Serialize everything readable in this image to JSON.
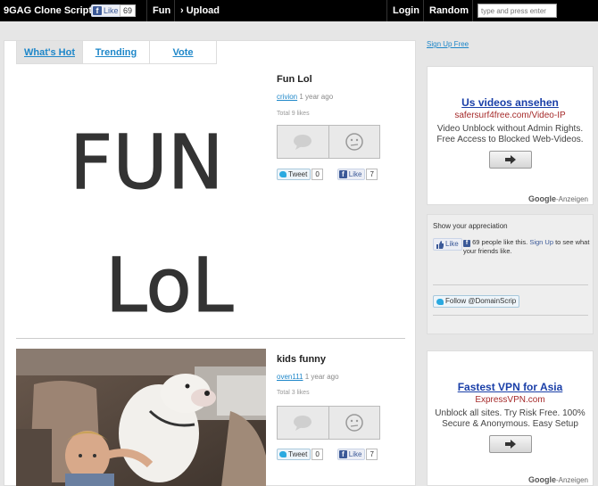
{
  "topbar": {
    "brand": "9GAG Clone Script",
    "like_label": "Like",
    "like_count": "69",
    "fun": "Fun",
    "upload": "› Upload",
    "login": "Login",
    "random": "Random",
    "search_placeholder": "type and press enter"
  },
  "tabs": [
    {
      "label": "What's Hot",
      "active": true
    },
    {
      "label": "Trending",
      "active": false
    },
    {
      "label": "Vote",
      "active": false
    }
  ],
  "posts": [
    {
      "title": "Fun Lol",
      "user": "crivion",
      "time": " 1 year ago",
      "likes": "Total 9 likes",
      "image_text": [
        "FUN",
        "LoL"
      ],
      "tweet_label": "Tweet",
      "tweet_count": "0",
      "fb_label": "Like",
      "fb_count": "7"
    },
    {
      "title": "kids funny",
      "user": "oven111",
      "time": " 1 year ago",
      "likes": "Total 3 likes",
      "tweet_label": "Tweet",
      "tweet_count": "0",
      "fb_label": "Like",
      "fb_count": "7"
    }
  ],
  "sidebar": {
    "signup": "Sign Up Free",
    "ads": [
      {
        "title": "Us videos ansehen",
        "url": "safersurf4free.com/Video-IP",
        "desc": "Video Unblock without Admin Rights. Free Access to Blocked Web-Videos.",
        "google": "Google",
        "google_suffix": "-Anzeigen"
      },
      {
        "title": "Fastest VPN for Asia",
        "url": "ExpressVPN.com",
        "desc": "Unblock all sites. Try Risk Free. 100% Secure & Anonymous. Easy Setup",
        "google": "Google",
        "google_suffix": "-Anzeigen"
      }
    ],
    "appreciation": {
      "title": "Show your appreciation",
      "like_label": "Like",
      "text_prefix": "69 people like this. ",
      "signup": "Sign Up",
      "text_suffix": " to see what your friends like.",
      "follow_label": "Follow @DomainScrip"
    }
  },
  "colors": {
    "link": "#1e87c9",
    "ad_title": "#1a3fa8",
    "ad_url": "#a52a2a",
    "facebook": "#3b5998",
    "topbar": "#000000"
  }
}
